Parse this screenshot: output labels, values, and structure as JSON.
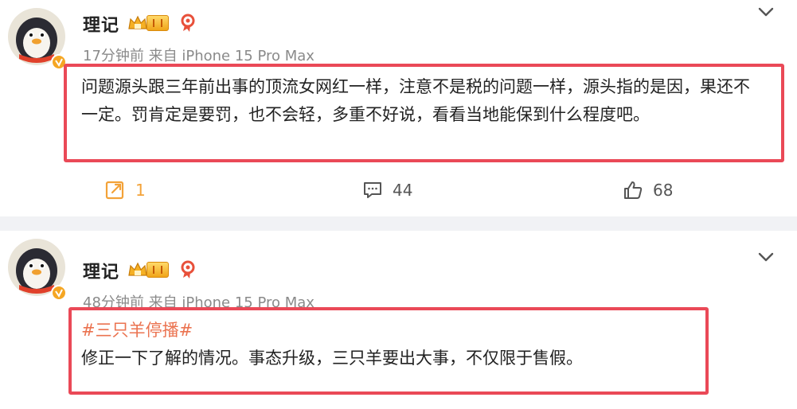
{
  "posts": [
    {
      "user": "理记",
      "meta": "17分钟前 来自 iPhone 15 Pro Max",
      "hashtag": "",
      "text": "问题源头跟三年前出事的顶流女网红一样，注意不是税的问题一样，源头指的是因，果还不一定。罚肯定是要罚，也不会轻，多重不好说，看看当地能保到什么程度吧。",
      "reposts": "1",
      "comments": "44",
      "likes": "68"
    },
    {
      "user": "理记",
      "meta": "48分钟前 来自 iPhone 15 Pro Max",
      "hashtag": "#三只羊停播#",
      "text": "修正一下了解的情况。事态升级，三只羊要出大事，不仅限于售假。"
    }
  ],
  "colors": {
    "highlight_box": "#ea4957",
    "hashtag": "#eb7350",
    "repost_icon": "#f3a238",
    "divider_bg": "#f1f2f5"
  },
  "icons": [
    "avatar-penguin",
    "vip-crown-icon",
    "medal-icon",
    "chevron-down-icon",
    "repost-icon",
    "comment-icon",
    "like-icon"
  ]
}
